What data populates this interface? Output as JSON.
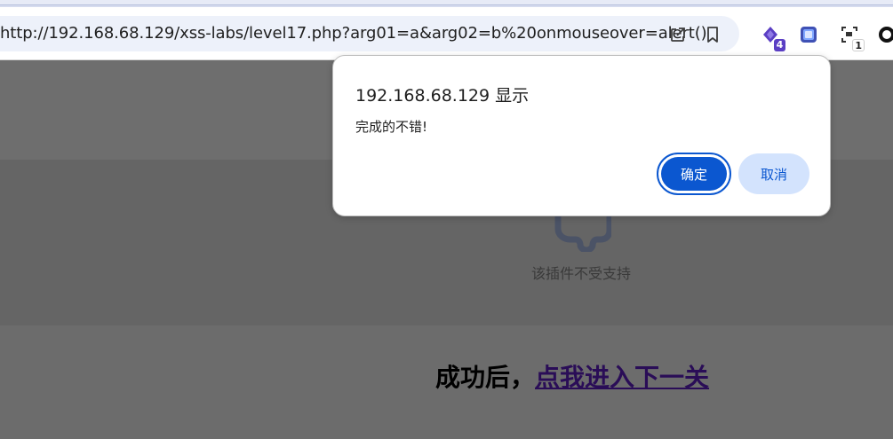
{
  "browser": {
    "url": "http://192.168.68.129/xss-labs/level17.php?arg01=a&arg02=b%20onmouseover=alert()",
    "icons": {
      "share": "share-icon",
      "bookmark": "bookmark-icon"
    },
    "extensions": [
      {
        "icon": "extension-diamond-icon",
        "badge": "4",
        "color": "#5b3fc4"
      },
      {
        "icon": "extension-screen-icon",
        "badge": "",
        "color": "#3f51b5"
      },
      {
        "icon": "extension-scan-icon",
        "badge": "1",
        "color": "#333333"
      },
      {
        "icon": "extension-ring-icon",
        "badge": "",
        "color": "#111111"
      }
    ]
  },
  "page": {
    "plugin_unsupported_text": "该插件不受支持",
    "headline_prefix": "成功后，",
    "headline_link": "点我进入下一关"
  },
  "dialog": {
    "title": "192.168.68.129 显示",
    "message": "完成的不错!",
    "ok_label": "确定",
    "cancel_label": "取消"
  },
  "colors": {
    "accent": "#0b57d0",
    "cancel_bg": "#d3e3fd",
    "overlay": "#6b6b6b",
    "link": "#2a0d57"
  }
}
